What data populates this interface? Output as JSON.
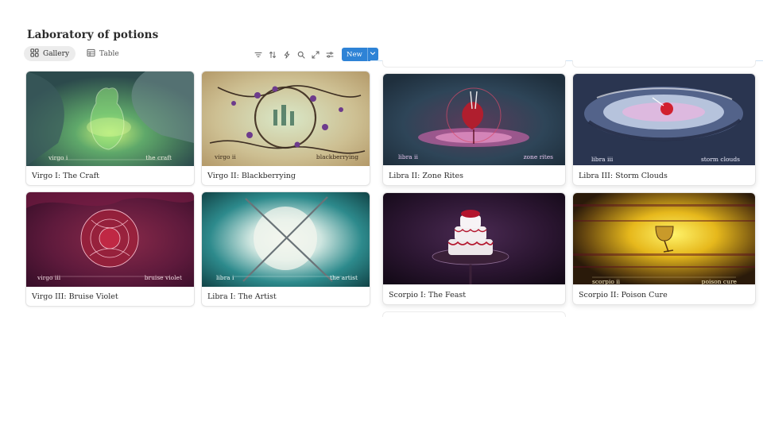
{
  "page": {
    "title": "Laboratory of potions"
  },
  "views": [
    {
      "label": "Gallery",
      "icon": "gallery-grid-icon",
      "active": true
    },
    {
      "label": "Table",
      "icon": "table-icon",
      "active": false
    }
  ],
  "toolbar": {
    "tools": [
      "filter-icon",
      "sort-icon",
      "automation-bolt-icon",
      "search-icon",
      "expand-icon",
      "settings-sliders-icon"
    ],
    "new_label": "New"
  },
  "cards": [
    {
      "title": "Virgo I: The Craft",
      "art": {
        "left": "virgo i",
        "right": "the craft"
      }
    },
    {
      "title": "Virgo II: Blackberrying",
      "art": {
        "left": "virgo ii",
        "right": "blackberrying"
      }
    },
    {
      "title": "Libra II: Zone Rites",
      "art": {
        "left": "libra ii",
        "right": "zone rites"
      }
    },
    {
      "title": "Libra III: Storm Clouds",
      "art": {
        "left": "libra iii",
        "right": "storm clouds"
      }
    },
    {
      "title": "Virgo III: Bruise Violet",
      "art": {
        "left": "virgo iii",
        "right": "bruise violet"
      }
    },
    {
      "title": "Libra I: The Artist",
      "art": {
        "left": "libra i",
        "right": "the artist"
      }
    },
    {
      "title": "Scorpio I: The Feast",
      "art": {
        "left": "",
        "right": ""
      }
    },
    {
      "title": "Scorpio II: Poison Cure",
      "art": {
        "left": "scorpio ii",
        "right": "poison cure"
      }
    }
  ]
}
